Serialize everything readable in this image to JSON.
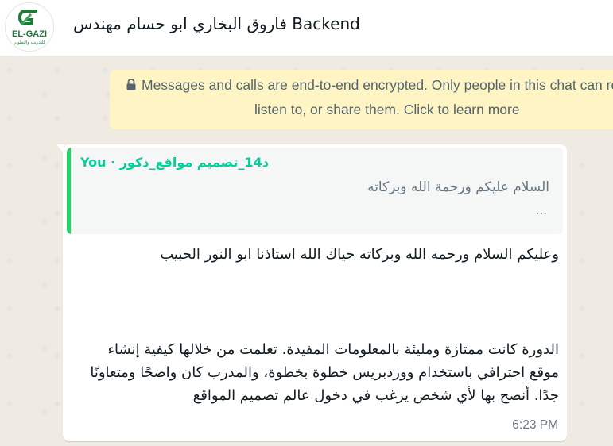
{
  "header": {
    "avatar_brand": "EL-GAZI",
    "avatar_sub": "للتدريب والتطوير",
    "chat_title": "فاروق البخاري ابو حسام مهندس Backend"
  },
  "encryption_notice": {
    "line1": "Messages and calls are end-to-end encrypted. Only people in this chat can read,",
    "line2": "listen to, or share them. Click to learn more"
  },
  "message": {
    "quoted": {
      "author": "You · د14_تصميم مواقع_ذكور",
      "text": "السلام عليكم ورحمة الله وبركاته",
      "more": "..."
    },
    "paragraph1": "وعليكم السلام ورحمه الله وبركاته حياك الله استاذنا ابو النور الحبيب",
    "paragraph2": "الدورة كانت ممتازة ومليئة بالمعلومات المفيدة. تعلمت من خلالها كيفية إنشاء موقع احترافي باستخدام ووردبريس خطوة بخطوة، والمدرب كان واضحًا ومتعاونًا جدًا. أنصح بها لأي شخص يرغب في دخول عالم تصميم المواقع",
    "time": "6:23 PM"
  },
  "colors": {
    "chat_background": "#efeae2",
    "encryption_background": "#fff5c4",
    "quote_accent": "#25d366",
    "quote_author": "#06cf9c",
    "brand_green": "#1f7a3a"
  }
}
